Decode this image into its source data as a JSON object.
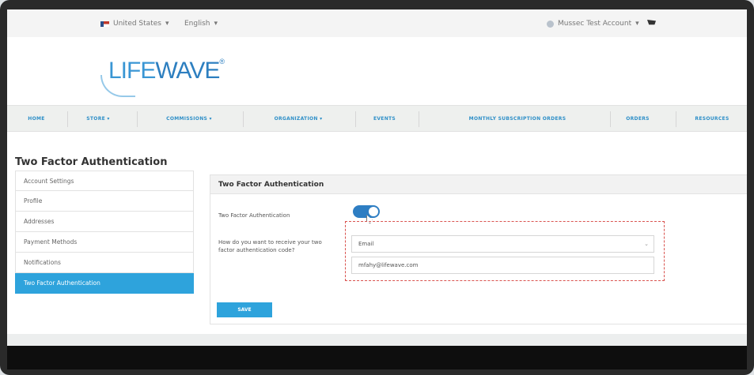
{
  "topbar": {
    "country": "United States",
    "language": "English",
    "account": "Mussec Test Account",
    "caret": "▾"
  },
  "logo": {
    "text_life": "LIFE",
    "text_wave": "WAVE",
    "mark": "®"
  },
  "nav": {
    "items": [
      {
        "label": "HOME"
      },
      {
        "label": "STORE ▾"
      },
      {
        "label": "COMMISSIONS ▾"
      },
      {
        "label": "ORGANIZATION ▾"
      },
      {
        "label": "EVENTS"
      },
      {
        "label": "MONTHLY SUBSCRIPTION ORDERS"
      },
      {
        "label": "ORDERS"
      },
      {
        "label": "RESOURCES"
      }
    ]
  },
  "page": {
    "title": "Two Factor Authentication"
  },
  "sidebar": {
    "items": [
      {
        "label": "Account Settings"
      },
      {
        "label": "Profile"
      },
      {
        "label": "Addresses"
      },
      {
        "label": "Payment Methods"
      },
      {
        "label": "Notifications"
      },
      {
        "label": "Two Factor Authentication"
      }
    ]
  },
  "panel": {
    "title": "Two Factor Authentication",
    "toggle_label": "Two Factor Authentication",
    "method_question": "How do you want to receive your two factor authentication code?",
    "method_value": "Email",
    "method_chevron": "⌄",
    "email_value": "mfahy@lifewave.com",
    "save_label": "SAVE"
  },
  "colors": {
    "accent": "#2ea3dc",
    "toggle_on": "#2e7ec3",
    "highlight_border": "#d9534f"
  },
  "icons": [
    "flag-us-icon",
    "user-icon",
    "cart-icon",
    "chevron-down-icon",
    "cursor-icon"
  ]
}
